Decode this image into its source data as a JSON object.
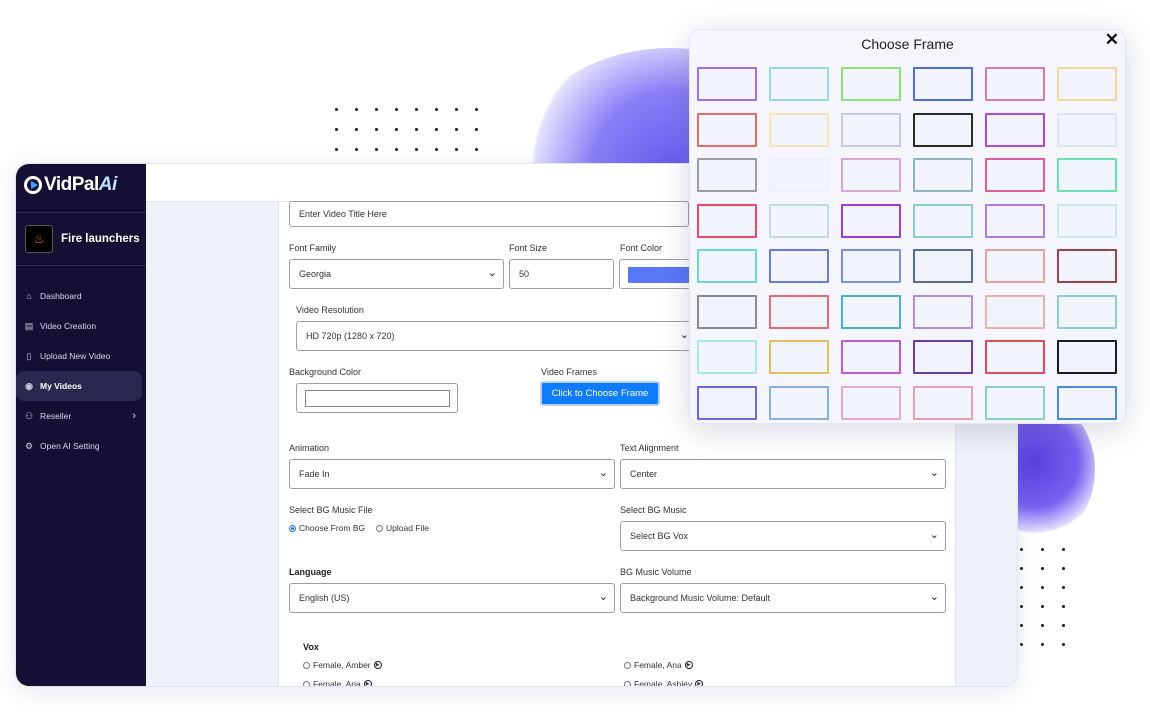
{
  "brand": {
    "logo_main": "VidPal",
    "logo_ai": "Ai"
  },
  "profile": {
    "name": "Fire launchers"
  },
  "sidebar": {
    "items": [
      {
        "label": "Dashboard",
        "icon": "home-icon",
        "glyph": "⌂"
      },
      {
        "label": "Video Creation",
        "icon": "film-icon",
        "glyph": "▤"
      },
      {
        "label": "Upload New Video",
        "icon": "document-icon",
        "glyph": "▯"
      },
      {
        "label": "My Videos",
        "icon": "play-circle-icon",
        "glyph": "◉",
        "active": true
      },
      {
        "label": "Reseller",
        "icon": "users-icon",
        "glyph": "⚇",
        "chevron": "›"
      },
      {
        "label": "Open AI Setting",
        "icon": "user-gear-icon",
        "glyph": "⚙"
      }
    ]
  },
  "form": {
    "title_placeholder": "Enter Video Title Here",
    "font_family_label": "Font Family",
    "font_family_value": "Georgia",
    "font_size_label": "Font Size",
    "font_size_value": "50",
    "font_color_label": "Font Color",
    "font_color_value": "#5878f5",
    "resolution_label": "Video Resolution",
    "resolution_value": "HD 720p (1280 x 720)",
    "bg_color_label": "Background Color",
    "video_frames_label": "Video Frames",
    "choose_frame_button": "Click to Choose Frame",
    "animation_label": "Animation",
    "animation_value": "Fade In",
    "text_alignment_label": "Text Alignment",
    "text_alignment_value": "Center",
    "bg_music_file_label": "Select BG Music File",
    "radio_choose_from_bg": "Choose From BG",
    "radio_upload_file": "Upload File",
    "bg_music_label": "Select BG Music",
    "bg_music_value": "Select BG Vox",
    "language_label": "Language",
    "language_value": "English (US)",
    "bg_volume_label": "BG Music Volume",
    "bg_volume_value": "Background Music Volume: Default",
    "vox_label": "Vox",
    "voices": [
      "Female, Amber",
      "Female, Ana",
      "Female, Aria",
      "Female, Ashley"
    ]
  },
  "modal": {
    "title": "Choose Frame",
    "close": "✕",
    "frame_colors": [
      "#a46cf0",
      "#9ad6e8",
      "#8fe07a",
      "#4f6ee0",
      "#e07aa4",
      "#f3d89a",
      "#ea6a6a",
      "#f5e4b8",
      "#c3cbe8",
      "#2a2a2a",
      "#b04ad8",
      "#dfe5f0",
      "#9a9aa8",
      "#eef2f8",
      "#d8a6d8",
      "#8fb4c8",
      "#e05c9a",
      "#6ce0b0",
      "#e84a6a",
      "#c4d8ea",
      "#a03ae0",
      "#8ecad8",
      "#b07ae8",
      "#cfe6ee",
      "#6ad6d6",
      "#6a7ad8",
      "#7a90e0",
      "#5a6a9a",
      "#e8a0a0",
      "#a0404a",
      "#8a8a8a",
      "#e86a7a",
      "#4ab0d8",
      "#b48ae0",
      "#e8b0b0",
      "#8ecad8",
      "#a6e8e8",
      "#e0c05a",
      "#c05ad8",
      "#6a3ab0",
      "#e04a5a",
      "#1a1a2a",
      "#6a6ae0",
      "#8ab0d8",
      "#e8a8d0",
      "#e8a0b0",
      "#8ad0c0",
      "#4a8ae0"
    ]
  }
}
